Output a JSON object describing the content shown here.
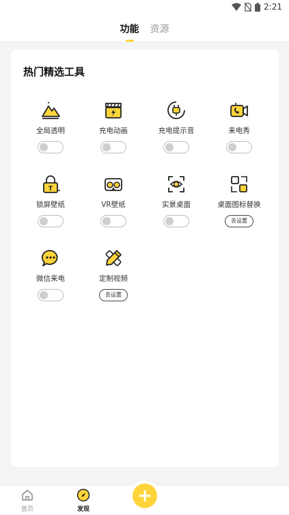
{
  "status_bar": {
    "time": "2:21"
  },
  "header": {
    "tabs": [
      {
        "label": "功能",
        "active": true
      },
      {
        "label": "资源",
        "active": false
      }
    ]
  },
  "section": {
    "title": "热门精选工具",
    "tools": [
      {
        "label": "全局透明",
        "icon": "mountain-icon",
        "control": "toggle",
        "enabled": false
      },
      {
        "label": "充电动画",
        "icon": "clapperboard-icon",
        "control": "toggle",
        "enabled": false
      },
      {
        "label": "充电提示音",
        "icon": "plug-icon",
        "control": "toggle",
        "enabled": false
      },
      {
        "label": "来电秀",
        "icon": "video-call-icon",
        "control": "toggle",
        "enabled": false
      },
      {
        "label": "锁屏壁纸",
        "icon": "lock-icon",
        "control": "toggle",
        "enabled": false
      },
      {
        "label": "VR壁纸",
        "icon": "vr-headset-icon",
        "control": "toggle",
        "enabled": false
      },
      {
        "label": "实景桌面",
        "icon": "eye-scan-icon",
        "control": "toggle",
        "enabled": false
      },
      {
        "label": "桌面图标替换",
        "icon": "icon-swap-icon",
        "control": "button",
        "button_label": "去设置"
      },
      {
        "label": "微信来电",
        "icon": "wechat-call-icon",
        "control": "toggle",
        "enabled": false
      },
      {
        "label": "定制视频",
        "icon": "pencil-ruler-icon",
        "control": "button",
        "button_label": "去设置"
      }
    ]
  },
  "bottom_nav": {
    "items": [
      {
        "label": "首页",
        "icon": "home-icon",
        "active": false
      },
      {
        "label": "发现",
        "icon": "compass-icon",
        "active": true
      }
    ],
    "fab_icon": "plus-icon"
  },
  "colors": {
    "accent": "#ffd43a",
    "background": "#f4f4f4",
    "card": "#ffffff"
  }
}
